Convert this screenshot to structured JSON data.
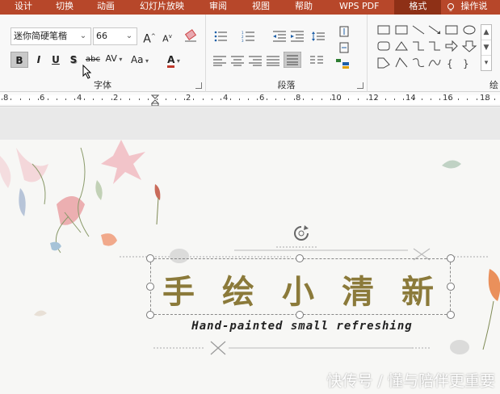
{
  "menu": {
    "items": [
      "设计",
      "切换",
      "动画",
      "幻灯片放映",
      "审阅",
      "视图",
      "帮助",
      "WPS PDF",
      "格式",
      "操作说"
    ],
    "active": "格式"
  },
  "ribbon": {
    "font_group": {
      "label": "字体",
      "font_name": "迷你简硬笔楷",
      "font_size": "66",
      "bold": "B",
      "italic": "I",
      "underline": "U",
      "shadow": "S",
      "strike": "abc",
      "spacing": "AV",
      "case": "Aa",
      "color_letter": "A",
      "grow": "A",
      "shrink": "A"
    },
    "paragraph_group": {
      "label": "段落"
    },
    "drawing_group": {
      "label": "绘"
    }
  },
  "ruler": {
    "labels": [
      "8",
      "6",
      "4",
      "2",
      "2",
      "4",
      "6",
      "8",
      "10",
      "12",
      "14",
      "16",
      "18"
    ]
  },
  "slide": {
    "title": [
      "手",
      "绘",
      "小",
      "清",
      "新"
    ],
    "subtitle": "Hand-painted small refreshing"
  },
  "watermark": "快传号 / 懂与陪伴更重要",
  "colors": {
    "menubar": "#b7472a",
    "title": "#8b7a3a",
    "accent_red": "#c0392b"
  }
}
